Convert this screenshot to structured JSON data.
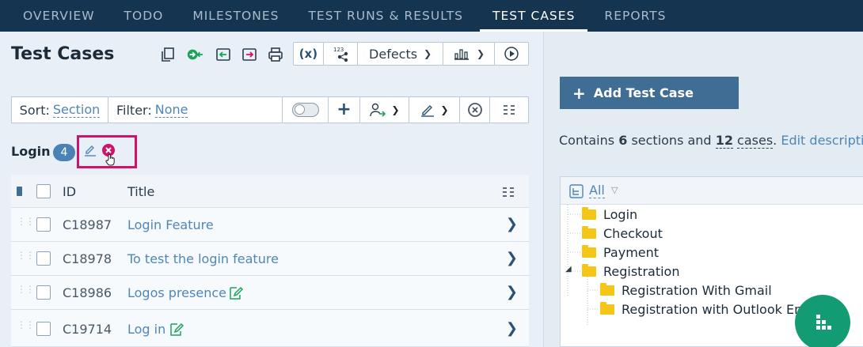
{
  "nav": {
    "tabs": [
      {
        "label": "OVERVIEW"
      },
      {
        "label": "TODO"
      },
      {
        "label": "MILESTONES"
      },
      {
        "label": "TEST RUNS & RESULTS"
      },
      {
        "label": "TEST CASES",
        "active": true
      },
      {
        "label": "REPORTS"
      }
    ]
  },
  "page": {
    "title": "Test Cases"
  },
  "toolbar": {
    "defects_label": "Defects"
  },
  "sortbar": {
    "sort_label": "Sort:",
    "sort_value": "Section",
    "filter_label": "Filter:",
    "filter_value": "None"
  },
  "section": {
    "name": "Login",
    "count": "4"
  },
  "table": {
    "headers": {
      "id": "ID",
      "title": "Title"
    },
    "rows": [
      {
        "id": "C18987",
        "title": "Login Feature",
        "edit_icon": false
      },
      {
        "id": "C18978",
        "title": "To test the login feature",
        "edit_icon": false
      },
      {
        "id": "C18986",
        "title": "Logos presence",
        "edit_icon": true
      },
      {
        "id": "C19714",
        "title": "Log in",
        "edit_icon": true
      }
    ]
  },
  "right": {
    "add_button": "Add Test Case",
    "contains_prefix": "Contains",
    "sections_count": "6",
    "sections_word": "sections and",
    "cases_count": "12",
    "cases_word": "cases",
    "edit_description": "Edit description",
    "tree_filter": "All",
    "tree": [
      {
        "label": "Login"
      },
      {
        "label": "Checkout"
      },
      {
        "label": "Payment"
      },
      {
        "label": "Registration"
      },
      {
        "label": "Registration With Gmail"
      },
      {
        "label": "Registration with Outlook Ema"
      }
    ]
  },
  "colors": {
    "nav_bg": "#14344f",
    "accent_blue": "#4f86b8",
    "highlight": "#d0126b",
    "fab_green": "#139c73",
    "folder": "#f5c518"
  }
}
